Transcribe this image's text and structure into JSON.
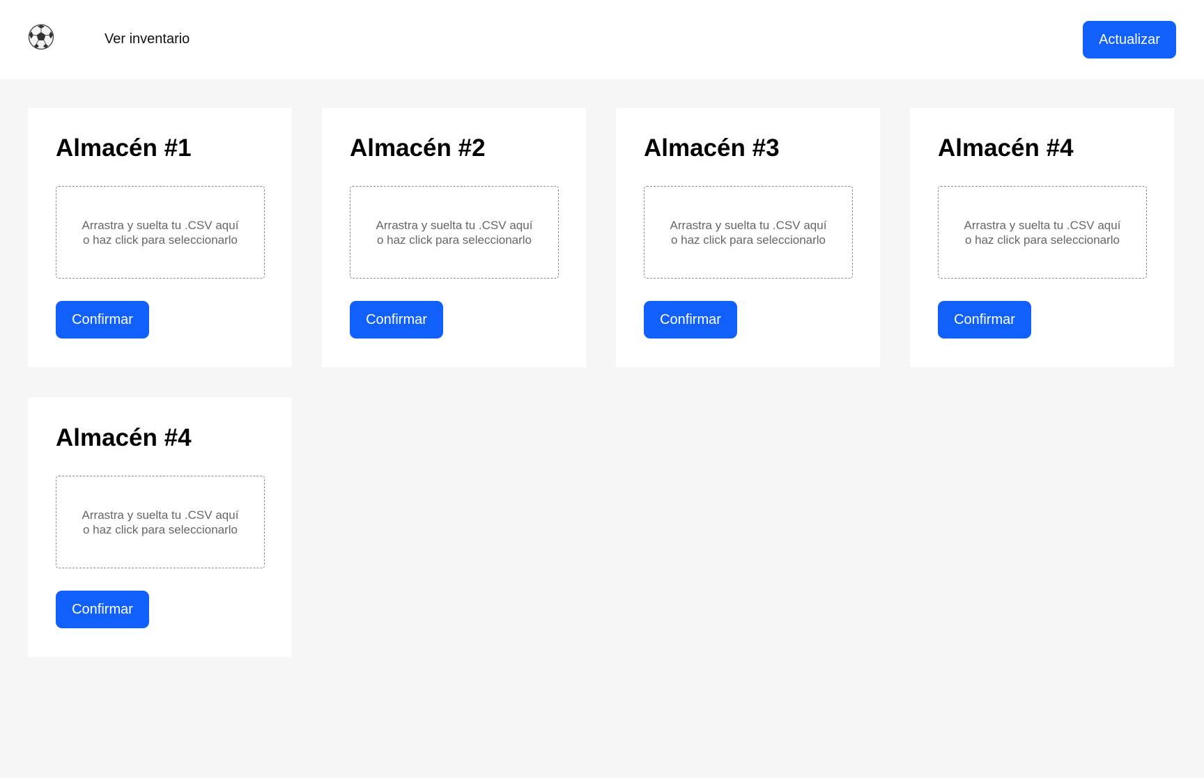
{
  "header": {
    "logo_icon": "soccer-ball-icon",
    "nav_link": "Ver inventario",
    "refresh_label": "Actualizar"
  },
  "colors": {
    "accent": "#1160fb",
    "background": "#f6f6f6",
    "card": "#ffffff"
  },
  "warehouses": [
    {
      "title": "Almacén #1",
      "dropzone_text": "Arrastra y suelta tu .CSV aquí\no haz click para seleccionarlo",
      "confirm_label": "Confirmar"
    },
    {
      "title": "Almacén #2",
      "dropzone_text": "Arrastra y suelta tu .CSV aquí\no haz click para seleccionarlo",
      "confirm_label": "Confirmar"
    },
    {
      "title": "Almacén #3",
      "dropzone_text": "Arrastra y suelta tu .CSV aquí\no haz click para seleccionarlo",
      "confirm_label": "Confirmar"
    },
    {
      "title": "Almacén #4",
      "dropzone_text": "Arrastra y suelta tu .CSV aquí\no haz click para seleccionarlo",
      "confirm_label": "Confirmar"
    },
    {
      "title": "Almacén #4",
      "dropzone_text": "Arrastra y suelta tu .CSV aquí\no haz click para seleccionarlo",
      "confirm_label": "Confirmar"
    }
  ]
}
